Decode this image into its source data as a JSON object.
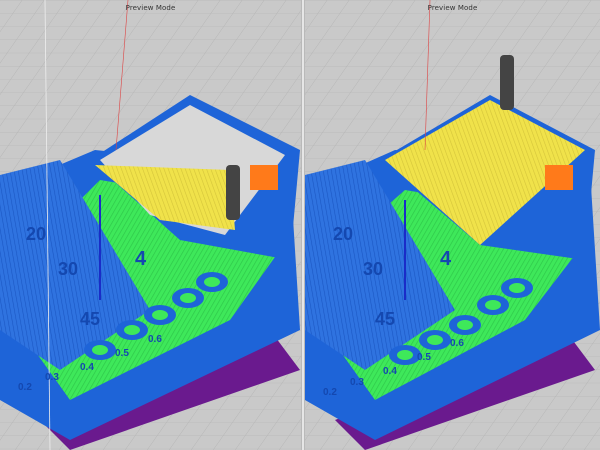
{
  "viewports": [
    {
      "mode_label": "Preview Mode"
    },
    {
      "mode_label": "Preview Mode"
    }
  ],
  "part_labels": [
    "0.2",
    "0.3",
    "0.4",
    "0.5",
    "0.6"
  ],
  "angle_labels": [
    "20",
    "30",
    "45",
    "4"
  ],
  "colors": {
    "background": "#c9c9c9",
    "grid": "#b4b4b4",
    "part_blue": "#1e64d8",
    "part_blue_dark": "#1448b0",
    "infill_green": "#3ee85a",
    "top_yellow": "#f0e24a",
    "orange_marker": "#ff7a1a",
    "purple_base": "#6a1a8e",
    "nozzle": "#444444"
  }
}
